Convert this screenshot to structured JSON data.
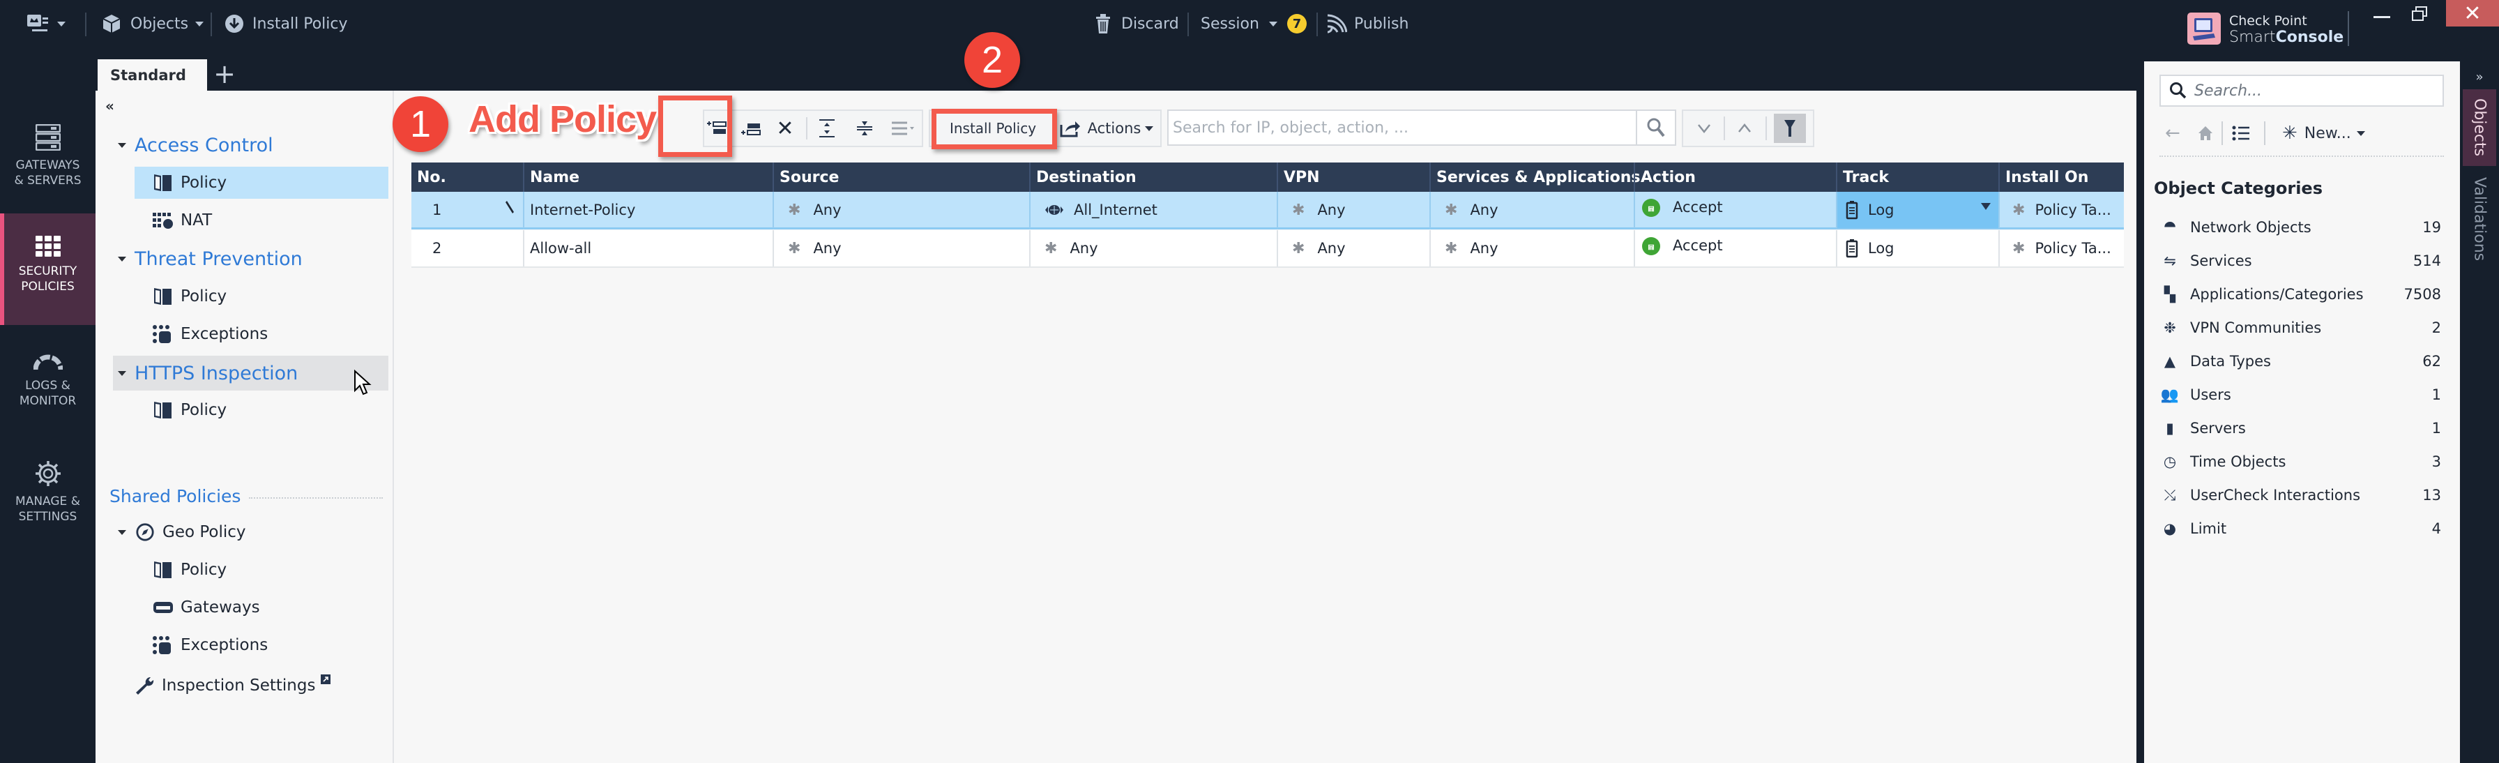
{
  "topbar": {
    "app_menu_icon": "app-menu-icon",
    "objects_label": "Objects",
    "install_policy_label": "Install Policy",
    "discard_label": "Discard",
    "session_label": "Session",
    "session_badge": "7",
    "publish_label": "Publish",
    "brand_line1": "Check Point",
    "brand_line2_light": "Smart",
    "brand_line2_bold": "Console",
    "colors": {
      "background": "#161f2c",
      "badge": "#f6cc2e",
      "close": "#c75c5c"
    }
  },
  "navrail": {
    "items": [
      {
        "label_line1": "GATEWAYS",
        "label_line2": "& SERVERS",
        "icon": "gateways-icon",
        "active": false
      },
      {
        "label_line1": "SECURITY",
        "label_line2": "POLICIES",
        "icon": "security-policies-icon",
        "active": true
      },
      {
        "label_line1": "LOGS &",
        "label_line2": "MONITOR",
        "icon": "logs-monitor-icon",
        "active": false
      },
      {
        "label_line1": "MANAGE &",
        "label_line2": "SETTINGS",
        "icon": "manage-settings-icon",
        "active": false
      }
    ],
    "active_color": "#4b2d44",
    "active_accent": "#e9537f"
  },
  "tabs": {
    "items": [
      {
        "label": "Standard",
        "active": true
      }
    ],
    "add_label": "+"
  },
  "tree": {
    "collapse_label": "«",
    "sections": [
      {
        "label": "Access Control",
        "children": [
          "Policy",
          "NAT"
        ]
      },
      {
        "label": "Threat Prevention",
        "children": [
          "Policy",
          "Exceptions"
        ]
      },
      {
        "label": "HTTPS Inspection",
        "children": [
          "Policy"
        ]
      }
    ],
    "shared_title": "Shared Policies",
    "geo_policy": {
      "label": "Geo Policy",
      "children": [
        "Policy",
        "Gateways",
        "Exceptions"
      ]
    },
    "inspection_settings": "Inspection Settings",
    "selected": "Access Control / Policy",
    "hovered": "HTTPS Inspection"
  },
  "toolbar": {
    "add_rule_above": "add-rule-above-icon",
    "add_rule_below": "add-rule-below-icon",
    "delete": "delete-icon",
    "install_policy_label": "Install Policy",
    "actions_label": "Actions",
    "search_placeholder": "Search for IP, object, action, ..."
  },
  "annotations": {
    "step1_number": "1",
    "step1_text": "Add Policy",
    "step2_number": "2",
    "color": "#f04438"
  },
  "rules_table": {
    "columns": [
      "No.",
      "Name",
      "Source",
      "Destination",
      "VPN",
      "Services & Applications",
      "Action",
      "Track",
      "Install On"
    ],
    "rows": [
      {
        "no": "1",
        "name": "Internet-Policy",
        "source": "Any",
        "destination": "All_Internet",
        "vpn": "Any",
        "services": "Any",
        "action": "Accept",
        "track": "Log",
        "install_on": "Policy Ta...",
        "selected": true
      },
      {
        "no": "2",
        "name": "Allow-all",
        "source": "Any",
        "destination": "Any",
        "vpn": "Any",
        "services": "Any",
        "action": "Accept",
        "track": "Log",
        "install_on": "Policy Ta...",
        "selected": false
      }
    ],
    "colors": {
      "header": "#2d3d55",
      "selected_row": "#bee3fb",
      "selected_cell": "#78c4f4",
      "accept": "#3fa535"
    }
  },
  "objects_panel": {
    "search_placeholder": "Search...",
    "new_label": "New...",
    "categories_title": "Object Categories",
    "categories": [
      {
        "label": "Network Objects",
        "count": "19",
        "icon": "network-objects-icon"
      },
      {
        "label": "Services",
        "count": "514",
        "icon": "services-icon"
      },
      {
        "label": "Applications/Categories",
        "count": "7508",
        "icon": "applications-icon"
      },
      {
        "label": "VPN Communities",
        "count": "2",
        "icon": "vpn-communities-icon"
      },
      {
        "label": "Data Types",
        "count": "62",
        "icon": "data-types-icon"
      },
      {
        "label": "Users",
        "count": "1",
        "icon": "users-icon"
      },
      {
        "label": "Servers",
        "count": "1",
        "icon": "servers-icon"
      },
      {
        "label": "Time Objects",
        "count": "3",
        "icon": "time-objects-icon"
      },
      {
        "label": "UserCheck Interactions",
        "count": "13",
        "icon": "usercheck-icon"
      },
      {
        "label": "Limit",
        "count": "4",
        "icon": "limit-icon"
      }
    ]
  },
  "vertical_tabs": {
    "expand_label": "»",
    "items": [
      {
        "label": "Objects",
        "active": true
      },
      {
        "label": "Validations",
        "active": false
      }
    ]
  }
}
